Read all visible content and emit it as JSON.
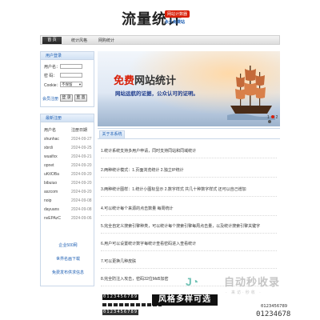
{
  "header": {
    "logo_text": "流量统计",
    "badge_red": "网站计数器",
    "badge_blue": "永久免费站"
  },
  "nav": {
    "items": [
      "首 页",
      "统计风格",
      "网购统计"
    ]
  },
  "login": {
    "title": "用户登录",
    "username_label": "用户名：",
    "password_label": "密  码：",
    "cookie_label": "Cookie：",
    "cookie_option": "不保留",
    "register_link": "会员注册",
    "login_button": "登 录",
    "reset_button": "重 置"
  },
  "recent": {
    "title": "最新注册",
    "col_user": "用户名",
    "col_date": "注册日期",
    "rows": [
      {
        "user": "shunhac",
        "date": "2024-09-27"
      },
      {
        "user": "xbrdi",
        "date": "2024-09-25"
      },
      {
        "user": "wuaifxx",
        "date": "2024-09-21"
      },
      {
        "user": "opnet",
        "date": "2024-09-20"
      },
      {
        "user": "uKtIOBa",
        "date": "2024-09-20"
      },
      {
        "user": "bibuiuo",
        "date": "2024-09-20"
      },
      {
        "user": "aszcom",
        "date": "2024-09-20"
      },
      {
        "user": "noip",
        "date": "2024-09-08"
      },
      {
        "user": "dayuans",
        "date": "2024-09-08"
      },
      {
        "user": "nvEPAzC",
        "date": "2024-09-06"
      }
    ]
  },
  "side_links": [
    "企业500网",
    "世界名画下载",
    "免费发布供求信息"
  ],
  "banner": {
    "title_red": "免费",
    "title_rest": "网站统计",
    "subtitle": "网站运航的证据，公众认可的证明。",
    "pager": [
      "1",
      "2"
    ]
  },
  "content": {
    "tab_label": "关于本系统",
    "features": [
      "1.统计系统支持多用户申请，同时支持同站和同域统计",
      "2.两种统计模式：1.页面浏览统计 2.独立IP统计",
      "3.两种统计图样：1.统计小图标显示 2.数字样式 共几十种数字样式 还可以自己增加",
      "4.可以统计每个来源的点击数量 每周统计",
      "5.完全自定义搜索引擎种类，可以统计每个搜索引擎每周点击量，以及统计搜索引擎关键字",
      "6.用户可以设置统计数字每统计查看密码进入查看统计",
      "7.可以更换几种皮肤",
      "8.完全防注入攻击，密码32位Md5加密"
    ]
  },
  "samples": {
    "counter_1": "0123456789",
    "counter_2": "0123456789",
    "style_bar": "风格多样可选",
    "outline_1": "0123456789",
    "outline_2": "01234678"
  },
  "watermark": {
    "text": "自动秒收录",
    "sub": "· 来访·秒收 ·"
  },
  "colors": {
    "accent_blue": "#1e5fb3",
    "brand_red": "#d81e06",
    "panel_border": "#c9d7e8"
  }
}
